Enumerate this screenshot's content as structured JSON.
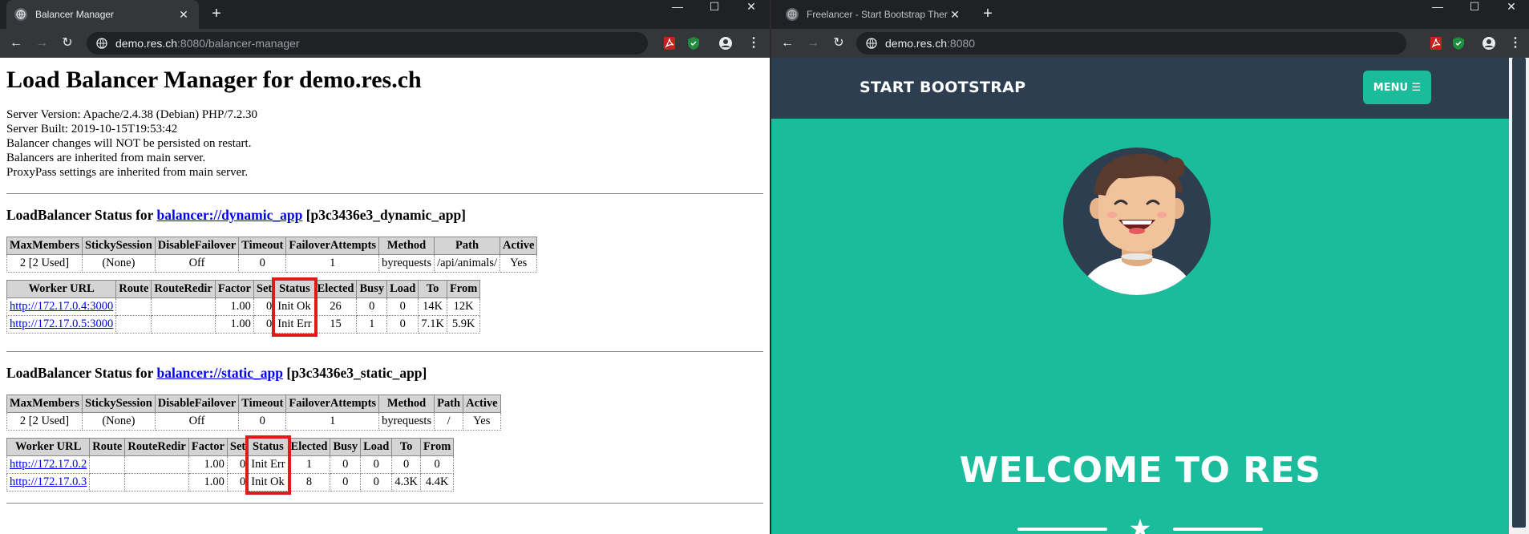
{
  "left_window": {
    "tab_title": "Balancer Manager",
    "url_host": "demo.res.ch",
    "url_rest": ":8080/balancer-manager",
    "page": {
      "title": "Load Balancer Manager for demo.res.ch",
      "info_lines": [
        "Server Version: Apache/2.4.38 (Debian) PHP/7.2.30",
        "Server Built: 2019-10-15T19:53:42",
        "Balancer changes will NOT be persisted on restart.",
        "Balancers are inherited from main server.",
        "ProxyPass settings are inherited from main server."
      ],
      "balancers": [
        {
          "heading_prefix": "LoadBalancer Status for ",
          "link": "balancer://dynamic_app",
          "heading_suffix": " [p3c3436e3_dynamic_app]",
          "settings_headers": [
            "MaxMembers",
            "StickySession",
            "DisableFailover",
            "Timeout",
            "FailoverAttempts",
            "Method",
            "Path",
            "Active"
          ],
          "settings_row": [
            "2 [2 Used]",
            "(None)",
            "Off",
            "0",
            "1",
            "byrequests",
            "/api/animals/",
            "Yes"
          ],
          "worker_headers": [
            "Worker URL",
            "Route",
            "RouteRedir",
            "Factor",
            "Set",
            "Status",
            "Elected",
            "Busy",
            "Load",
            "To",
            "From"
          ],
          "workers": [
            [
              "http://172.17.0.4:3000",
              "",
              "",
              "1.00",
              "0",
              "Init Ok",
              "26",
              "0",
              "0",
              "14K",
              "12K"
            ],
            [
              "http://172.17.0.5:3000",
              "",
              "",
              "1.00",
              "0",
              "Init Err",
              "15",
              "1",
              "0",
              "7.1K",
              "5.9K"
            ]
          ]
        },
        {
          "heading_prefix": "LoadBalancer Status for ",
          "link": "balancer://static_app",
          "heading_suffix": " [p3c3436e3_static_app]",
          "settings_headers": [
            "MaxMembers",
            "StickySession",
            "DisableFailover",
            "Timeout",
            "FailoverAttempts",
            "Method",
            "Path",
            "Active"
          ],
          "settings_row": [
            "2 [2 Used]",
            "(None)",
            "Off",
            "0",
            "1",
            "byrequests",
            "/",
            "Yes"
          ],
          "worker_headers": [
            "Worker URL",
            "Route",
            "RouteRedir",
            "Factor",
            "Set",
            "Status",
            "Elected",
            "Busy",
            "Load",
            "To",
            "From"
          ],
          "workers": [
            [
              "http://172.17.0.2",
              "",
              "",
              "1.00",
              "0",
              "Init Err",
              "1",
              "0",
              "0",
              "0",
              "0"
            ],
            [
              "http://172.17.0.3",
              "",
              "",
              "1.00",
              "0",
              "Init Ok",
              "8",
              "0",
              "0",
              "4.3K",
              "4.4K"
            ]
          ]
        }
      ]
    }
  },
  "right_window": {
    "tab_title": "Freelancer - Start Bootstrap Theme",
    "url_host": "demo.res.ch",
    "url_rest": ":8080",
    "brand": "START BOOTSTRAP",
    "menu_label": "MENU ☰",
    "heading": "WELCOME TO RES"
  },
  "colors": {
    "navy": "#2c3e50",
    "teal": "#1abc9c",
    "highlight_red": "#e0191b",
    "link_blue": "#0000ee"
  },
  "icons": [
    "globe-icon",
    "pdf-extension-icon",
    "shield-extension-icon",
    "account-icon",
    "kebab-menu-icon",
    "star-icon",
    "avatar-illustration"
  ]
}
